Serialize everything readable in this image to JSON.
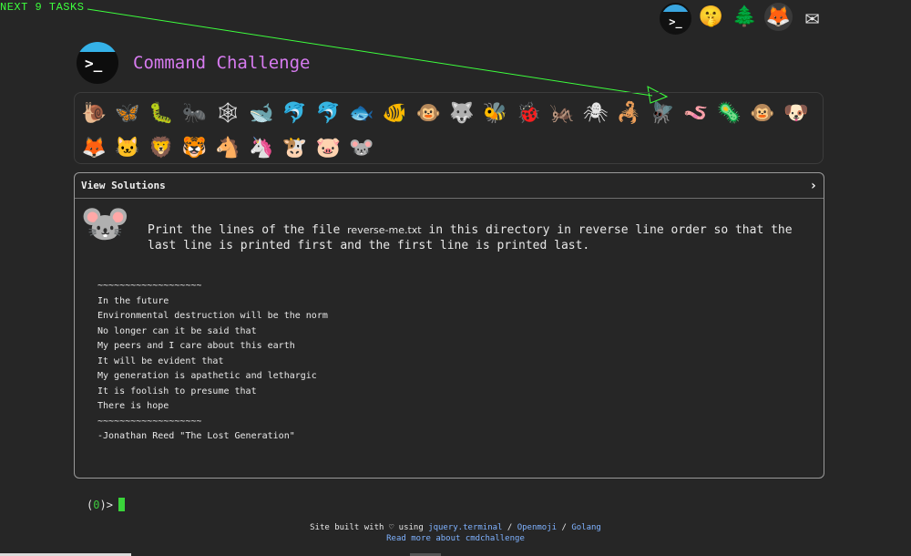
{
  "overlay": {
    "next_tasks_label": "NEXT 9 TASKS"
  },
  "top_icons": [
    {
      "name": "terminal-icon",
      "glyph": ">_"
    },
    {
      "name": "shush-face-icon",
      "glyph": "🤫"
    },
    {
      "name": "tree-icon",
      "glyph": "🌲"
    },
    {
      "name": "gitlab-icon",
      "glyph": "🦊"
    },
    {
      "name": "mail-icon",
      "glyph": "✉"
    }
  ],
  "header": {
    "logo_glyph": ">_",
    "title": "Command Challenge"
  },
  "animals": {
    "row1": [
      "🐌",
      "🦋",
      "🐛",
      "🐜",
      "🕸",
      "🐋",
      "🐬",
      "🐬",
      "🐟",
      "🐠",
      "🐵",
      "🐺",
      "🐝",
      "🐞",
      "🦗",
      "🕷",
      "🦂",
      "🪰",
      "🪱",
      "🦠",
      "🐵",
      "🐶"
    ],
    "row2": [
      "🦊",
      "🐱",
      "🦁",
      "🐯",
      "🐴",
      "🦄",
      "🐮",
      "🐷",
      "🐭"
    ]
  },
  "panel": {
    "view_solutions": "View Solutions",
    "chevron": "›",
    "mouse_glyph": "🐭",
    "task_before": "Print the lines of the file ",
    "task_file": "reverse-me.txt",
    "task_after": " in this directory in reverse line order so that the last line is printed first and the first line is printed last.",
    "poem": "~~~~~~~~~~~~~~~~~~~\nIn the future\nEnvironmental destruction will be the norm\nNo longer can it be said that\nMy peers and I care about this earth\nIt will be evident that\nMy generation is apathetic and lethargic\nIt is foolish to presume that\nThere is hope\n~~~~~~~~~~~~~~~~~~~\n-Jonathan Reed \"The Lost Generation\""
  },
  "prompt": {
    "open": "(",
    "num": "0",
    "close": ")>"
  },
  "footer": {
    "prefix": "Site built with ♡ using ",
    "link1": "jquery.terminal",
    "sep1": " / ",
    "link2": "Openmoji",
    "sep2": " / ",
    "link3": "Golang",
    "link4": "Read more about cmdchallenge"
  }
}
